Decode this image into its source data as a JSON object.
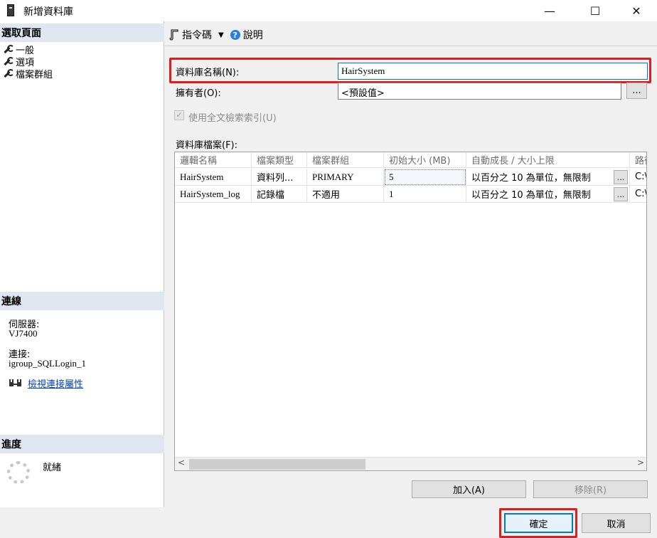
{
  "window": {
    "title": "新增資料庫",
    "minimize_glyph": "—",
    "maximize_glyph": "☐",
    "close_glyph": "✕"
  },
  "left": {
    "select_page_header": "選取頁面",
    "pages": [
      {
        "label": "一般",
        "icon": "wrench-icon"
      },
      {
        "label": "選項",
        "icon": "wrench-icon"
      },
      {
        "label": "檔案群組",
        "icon": "wrench-icon"
      }
    ],
    "connection_header": "連線",
    "server_label": "伺服器:",
    "server_value": "VJ7400",
    "connection_label": "連接:",
    "connection_value": "igroup_SQLLogin_1",
    "view_connection_link": "檢視連接屬性",
    "progress_header": "進度",
    "progress_status": "就緒"
  },
  "toolbar": {
    "script_label": "指令碼",
    "help_label": "說明"
  },
  "form": {
    "db_name_label": "資料庫名稱(N):",
    "db_name_value": "HairSystem",
    "owner_label": "擁有者(O):",
    "owner_value": "<預設值>",
    "owner_browse": "...",
    "fulltext_label": "使用全文檢索索引(U)",
    "fulltext_checked": true,
    "db_files_label": "資料庫檔案(F):"
  },
  "grid": {
    "columns": [
      "邏輯名稱",
      "檔案類型",
      "檔案群組",
      "初始大小 (MB)",
      "自動成長 / 大小上限",
      "路徑"
    ],
    "rows": [
      {
        "name": "HairSystem",
        "type": "資料列...",
        "group": "PRIMARY",
        "size": "5",
        "growth": "以百分之 10 為單位，無限制",
        "browse": "...",
        "path": "C:\\"
      },
      {
        "name": "HairSystem_log",
        "type": "記錄檔",
        "group": "不適用",
        "size": "1",
        "growth": "以百分之 10 為單位，無限制",
        "browse": "...",
        "path": "C:\\"
      }
    ],
    "scroll_left": "<",
    "scroll_right": ">"
  },
  "buttons": {
    "add": "加入(A)",
    "remove": "移除(R)",
    "ok": "確定",
    "cancel": "取消"
  },
  "colors": {
    "highlight_border": "#e01d1d",
    "section_header_bg": "#dfe6f0",
    "link": "#0645ad"
  }
}
